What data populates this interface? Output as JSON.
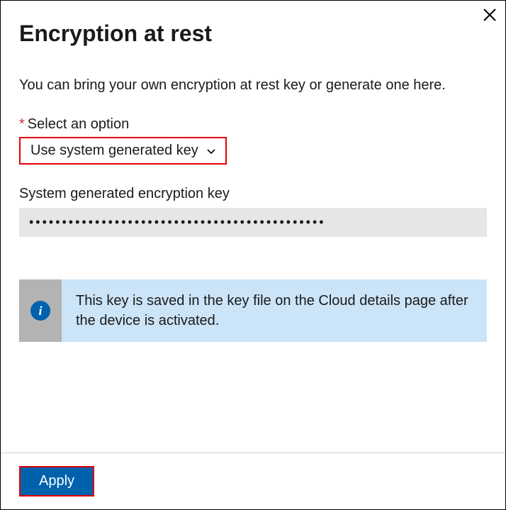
{
  "header": {
    "title": "Encryption at rest"
  },
  "body": {
    "description": "You can bring your own encryption at rest key or generate one here.",
    "select": {
      "label": "Select an option",
      "required_marker": "*",
      "value": "Use system generated key"
    },
    "key": {
      "label": "System generated encryption key",
      "value": "•••••••••••••••••••••••••••••••••••••••••••••"
    },
    "info": {
      "icon_glyph": "i",
      "text": "This key is saved in the key file on the Cloud details page after the device is activated."
    }
  },
  "footer": {
    "apply_label": "Apply"
  }
}
